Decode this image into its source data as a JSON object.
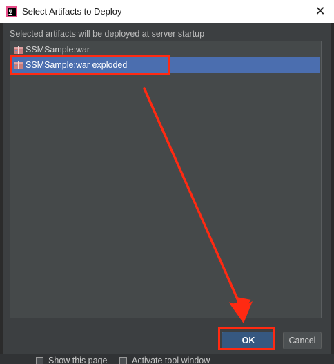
{
  "window": {
    "title": "Select Artifacts to Deploy",
    "app_icon": "intellij-idea-icon",
    "close_glyph": "✕"
  },
  "dialog": {
    "subtitle": "Selected artifacts will be deployed at server startup",
    "artifacts": [
      {
        "label": "SSMSample:war",
        "icon": "artifact-war-icon",
        "selected": false
      },
      {
        "label": "SSMSample:war exploded",
        "icon": "artifact-exploded-icon",
        "selected": true
      }
    ],
    "buttons": {
      "ok": "OK",
      "cancel": "Cancel"
    }
  },
  "background_panel": {
    "show_this_page": "Show this page",
    "activate_tool_window": "Activate tool window"
  },
  "colors": {
    "annotation": "#ff2a12",
    "selection": "#4b6eaf",
    "dialog_bg": "#3c3f41"
  }
}
